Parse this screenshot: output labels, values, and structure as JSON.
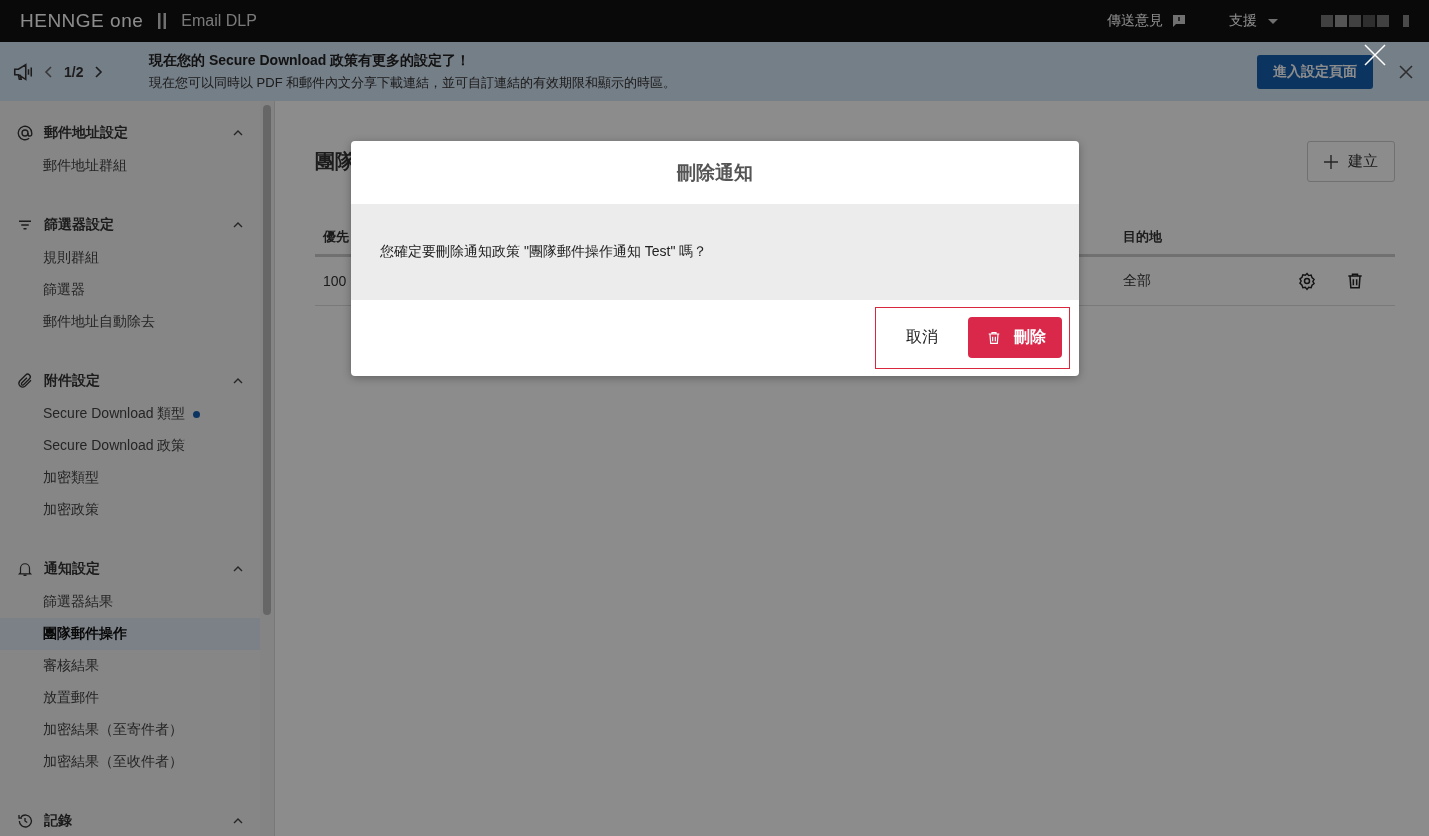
{
  "header": {
    "logo": "HENNGE one",
    "product": "Email DLP",
    "feedback": "傳送意見",
    "support": "支援"
  },
  "banner": {
    "pager": "1/2",
    "title": "現在您的 Secure Download 政策有更多的設定了！",
    "message": "現在您可以同時以 PDF 和郵件內文分享下載連結，並可自訂連結的有效期限和顯示的時區。",
    "action": "進入設定頁面"
  },
  "sidebar": {
    "sections": [
      {
        "kind": "at",
        "title": "郵件地址設定",
        "expanded": true,
        "items": [
          {
            "label": "郵件地址群組",
            "selected": false,
            "dot": false
          }
        ]
      },
      {
        "kind": "filter",
        "title": "篩選器設定",
        "expanded": true,
        "items": [
          {
            "label": "規則群組",
            "selected": false,
            "dot": false
          },
          {
            "label": "篩選器",
            "selected": false,
            "dot": false
          },
          {
            "label": "郵件地址自動除去",
            "selected": false,
            "dot": false
          }
        ]
      },
      {
        "kind": "clip",
        "title": "附件設定",
        "expanded": true,
        "items": [
          {
            "label": "Secure Download 類型",
            "selected": false,
            "dot": true
          },
          {
            "label": "Secure Download 政策",
            "selected": false,
            "dot": false
          },
          {
            "label": "加密類型",
            "selected": false,
            "dot": false
          },
          {
            "label": "加密政策",
            "selected": false,
            "dot": false
          }
        ]
      },
      {
        "kind": "bell",
        "title": "通知設定",
        "expanded": true,
        "items": [
          {
            "label": "篩選器結果",
            "selected": false,
            "dot": false
          },
          {
            "label": "團隊郵件操作",
            "selected": true,
            "dot": false
          },
          {
            "label": "審核結果",
            "selected": false,
            "dot": false
          },
          {
            "label": "放置郵件",
            "selected": false,
            "dot": false
          },
          {
            "label": "加密結果（至寄件者）",
            "selected": false,
            "dot": false
          },
          {
            "label": "加密結果（至收件者）",
            "selected": false,
            "dot": false
          }
        ]
      },
      {
        "kind": "history",
        "title": "記錄",
        "expanded": true
      }
    ]
  },
  "main": {
    "title": "團隊",
    "create": "建立",
    "columns": [
      "優先",
      "目的地"
    ],
    "rows": [
      {
        "cells": [
          "100",
          "全部"
        ]
      }
    ]
  },
  "modal": {
    "title": "刪除通知",
    "message": "您確定要刪除通知政策 \"團隊郵件操作通知 Test\" 嗎？",
    "cancel": "取消",
    "confirm": "刪除"
  }
}
